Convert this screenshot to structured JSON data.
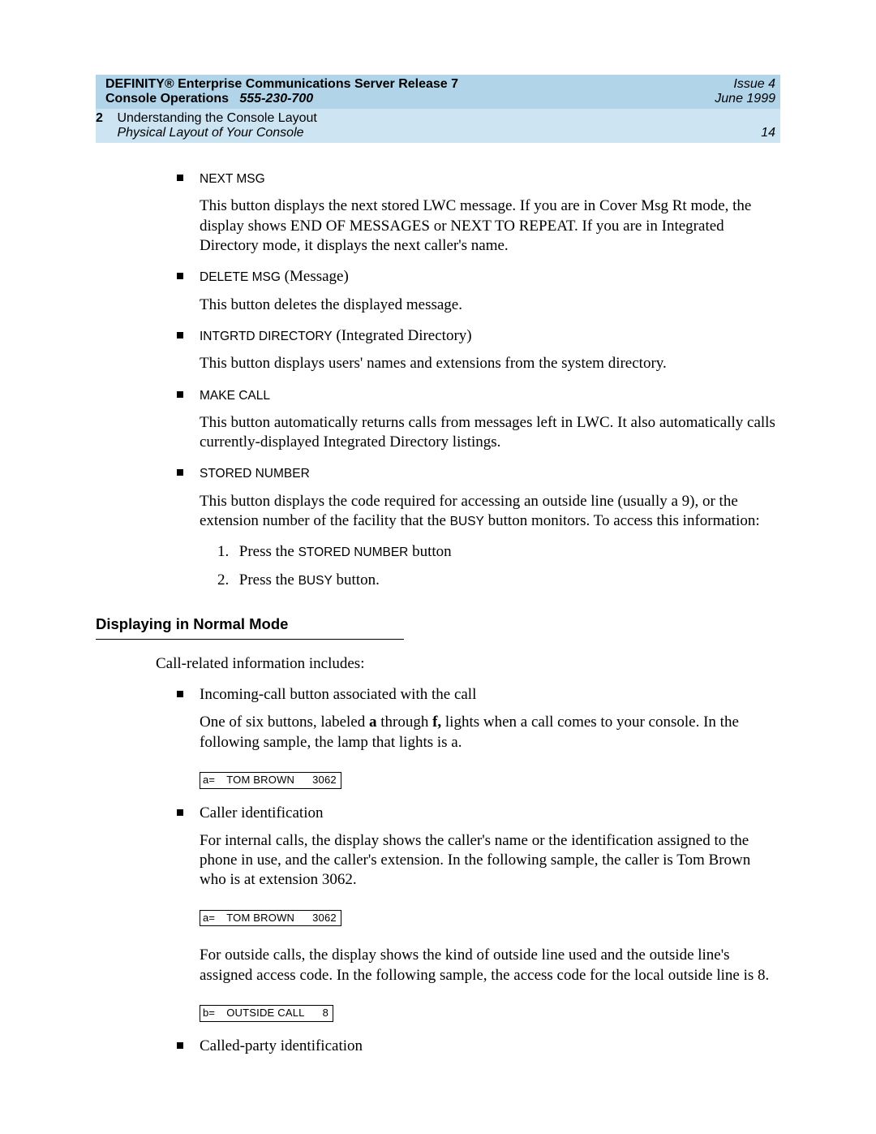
{
  "header": {
    "title_line1a": "DEFINITY® Enterprise Communications Server Release 7",
    "title_line1b_prefix": "Console Operations",
    "title_line1b_docnum": "555-230-700",
    "issue": "Issue 4",
    "date": "June 1999",
    "chapter_num": "2",
    "chapter_title": "Understanding the Console Layout",
    "section_title": "Physical Layout of Your Console",
    "page_num": "14"
  },
  "items": [
    {
      "label": "NEXT MSG",
      "extra": "",
      "body_parts": [
        {
          "t": "plain",
          "v": "This button displays the next stored LWC message. If you are in Cover Msg Rt mode, the display shows END OF MESSAGES or NEXT TO REPEAT. If you are in Integrated Directory mode, it displays the next caller's name."
        }
      ]
    },
    {
      "label": "DELETE MSG",
      "extra": " (Message)",
      "body_parts": [
        {
          "t": "plain",
          "v": "This button deletes the displayed message."
        }
      ]
    },
    {
      "label": "INTGRTD DIRECTORY",
      "extra": " (Integrated Directory)",
      "body_parts": [
        {
          "t": "plain",
          "v": "This button displays users' names and extensions from the system directory."
        }
      ]
    },
    {
      "label": "MAKE CALL",
      "extra": "",
      "body_parts": [
        {
          "t": "plain",
          "v": "This button automatically returns calls from messages left in LWC. It also automatically calls currently-displayed Integrated Directory listings."
        }
      ]
    },
    {
      "label": "STORED NUMBER",
      "extra": "",
      "body_parts": [
        {
          "t": "mixed1"
        }
      ],
      "steps": [
        {
          "pre": "Press the ",
          "mid": "STORED NUMBER",
          "post": " button"
        },
        {
          "pre": "Press the ",
          "mid": "BUSY",
          "post": " button."
        }
      ]
    }
  ],
  "stored_number_body": {
    "a": "This button displays the code required for accessing an outside line (usually a 9), or the extension number of the facility that the ",
    "b": "BUSY",
    "c": " button monitors. To access this information:"
  },
  "section2": {
    "heading": "Displaying in Normal Mode",
    "intro": "Call-related information includes:",
    "bullets": [
      {
        "title": "Incoming-call button associated with the call",
        "p1_a": "One of six buttons, labeled ",
        "p1_b": "a",
        "p1_c": " through ",
        "p1_d": "f,",
        "p1_e": " lights when a call comes to your console. In the following sample, the lamp that lights is a.",
        "display": {
          "prefix": "a=",
          "mid": "TOM BROWN",
          "suffix": "3062"
        }
      },
      {
        "title": "Caller identification",
        "p1": "For internal calls, the display shows the caller's name or the identification assigned to the phone in use, and the caller's extension. In the following sample, the caller is Tom Brown who is at extension 3062.",
        "display1": {
          "prefix": "a=",
          "mid": "TOM BROWN",
          "suffix": "3062"
        },
        "p2": "For outside calls, the display shows the kind of outside line used and the outside line's assigned access code. In the following sample, the access code for the local outside line is 8.",
        "display2": {
          "prefix": "b=",
          "mid": "OUTSIDE CALL",
          "suffix": "8"
        }
      },
      {
        "title": "Called-party identification"
      }
    ]
  }
}
